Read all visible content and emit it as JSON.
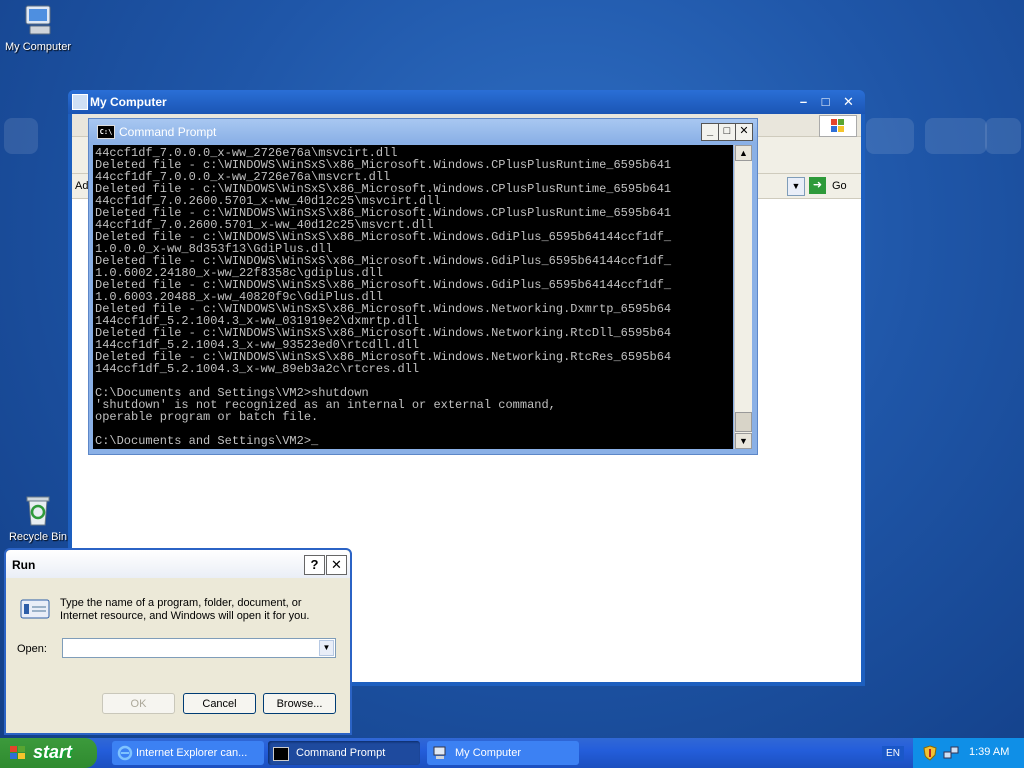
{
  "desktop": {
    "icons": [
      {
        "label": "My Computer"
      },
      {
        "label": "Recycle Bin"
      }
    ]
  },
  "my_computer": {
    "title": "My Computer",
    "address_label": "Ad",
    "go_label": "Go"
  },
  "cmd": {
    "title": "Command Prompt",
    "buffer": "44ccf1df_7.0.0.0_x-ww_2726e76a\\msvcirt.dll\nDeleted file - c:\\WINDOWS\\WinSxS\\x86_Microsoft.Windows.CPlusPlusRuntime_6595b641\n44ccf1df_7.0.0.0_x-ww_2726e76a\\msvcrt.dll\nDeleted file - c:\\WINDOWS\\WinSxS\\x86_Microsoft.Windows.CPlusPlusRuntime_6595b641\n44ccf1df_7.0.2600.5701_x-ww_40d12c25\\msvcirt.dll\nDeleted file - c:\\WINDOWS\\WinSxS\\x86_Microsoft.Windows.CPlusPlusRuntime_6595b641\n44ccf1df_7.0.2600.5701_x-ww_40d12c25\\msvcrt.dll\nDeleted file - c:\\WINDOWS\\WinSxS\\x86_Microsoft.Windows.GdiPlus_6595b64144ccf1df_\n1.0.0.0_x-ww_8d353f13\\GdiPlus.dll\nDeleted file - c:\\WINDOWS\\WinSxS\\x86_Microsoft.Windows.GdiPlus_6595b64144ccf1df_\n1.0.6002.24180_x-ww_22f8358c\\gdiplus.dll\nDeleted file - c:\\WINDOWS\\WinSxS\\x86_Microsoft.Windows.GdiPlus_6595b64144ccf1df_\n1.0.6003.20488_x-ww_40820f9c\\GdiPlus.dll\nDeleted file - c:\\WINDOWS\\WinSxS\\x86_Microsoft.Windows.Networking.Dxmrtp_6595b64\n144ccf1df_5.2.1004.3_x-ww_031919e2\\dxmrtp.dll\nDeleted file - c:\\WINDOWS\\WinSxS\\x86_Microsoft.Windows.Networking.RtcDll_6595b64\n144ccf1df_5.2.1004.3_x-ww_93523ed0\\rtcdll.dll\nDeleted file - c:\\WINDOWS\\WinSxS\\x86_Microsoft.Windows.Networking.RtcRes_6595b64\n144ccf1df_5.2.1004.3_x-ww_89eb3a2c\\rtcres.dll\n\nC:\\Documents and Settings\\VM2>shutdown\n'shutdown' is not recognized as an internal or external command,\noperable program or batch file.\n\nC:\\Documents and Settings\\VM2>_"
  },
  "run_dialog": {
    "title": "Run",
    "help_glyph": "?",
    "close_glyph": "✕",
    "description": "Type the name of a program, folder, document, or Internet resource, and Windows will open it for you.",
    "open_label": "Open:",
    "open_value": "",
    "ok_label": "OK",
    "cancel_label": "Cancel",
    "browse_label": "Browse..."
  },
  "taskbar": {
    "start_label": "start",
    "tasks": [
      {
        "label": "Internet Explorer can..."
      },
      {
        "label": "Command Prompt"
      },
      {
        "label": "My Computer"
      }
    ],
    "language": "EN",
    "clock": "1:39 AM"
  },
  "colors": {
    "desktop_blue": "#1f56a8",
    "titlebar_blue": "#1b55b4",
    "start_green": "#2f8b2f",
    "tray_blue": "#0f8fe7"
  }
}
